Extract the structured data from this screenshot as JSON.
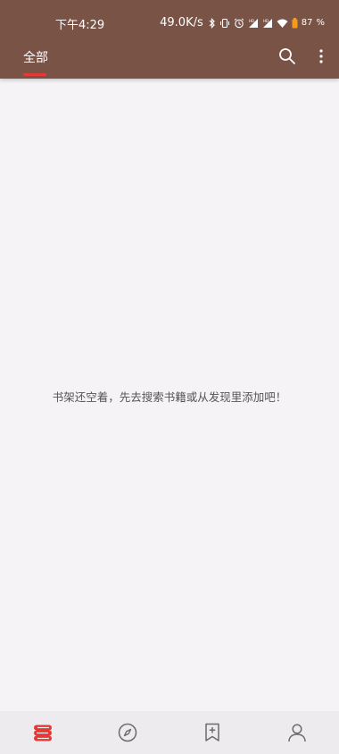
{
  "status_bar": {
    "time": "下午4:29",
    "net_speed": "49.0K/s",
    "battery": "87",
    "battery_unit": "%",
    "icons": [
      "bluetooth-icon",
      "vibrate-icon",
      "alarm-icon",
      "signal-hd-icon",
      "signal-icon",
      "wifi-icon",
      "battery-icon"
    ]
  },
  "toolbar": {
    "tabs": [
      {
        "label": "全部",
        "selected": true
      }
    ],
    "icons": [
      "search-icon",
      "more-vert-icon"
    ]
  },
  "empty_state": {
    "message": "书架还空着，先去搜索书籍或从发现里添加吧！"
  },
  "bottom_nav": {
    "items": [
      {
        "icon": "bookshelf-icon",
        "selected": true
      },
      {
        "icon": "compass-icon",
        "selected": false
      },
      {
        "icon": "bookmark-add-icon",
        "selected": false
      },
      {
        "icon": "person-icon",
        "selected": false
      }
    ]
  },
  "colors": {
    "header": "#7a5347",
    "accent": "#e53935",
    "background": "#f5f3f6",
    "nav_background": "#eeebee",
    "icon_inactive": "#6b6b6b"
  }
}
